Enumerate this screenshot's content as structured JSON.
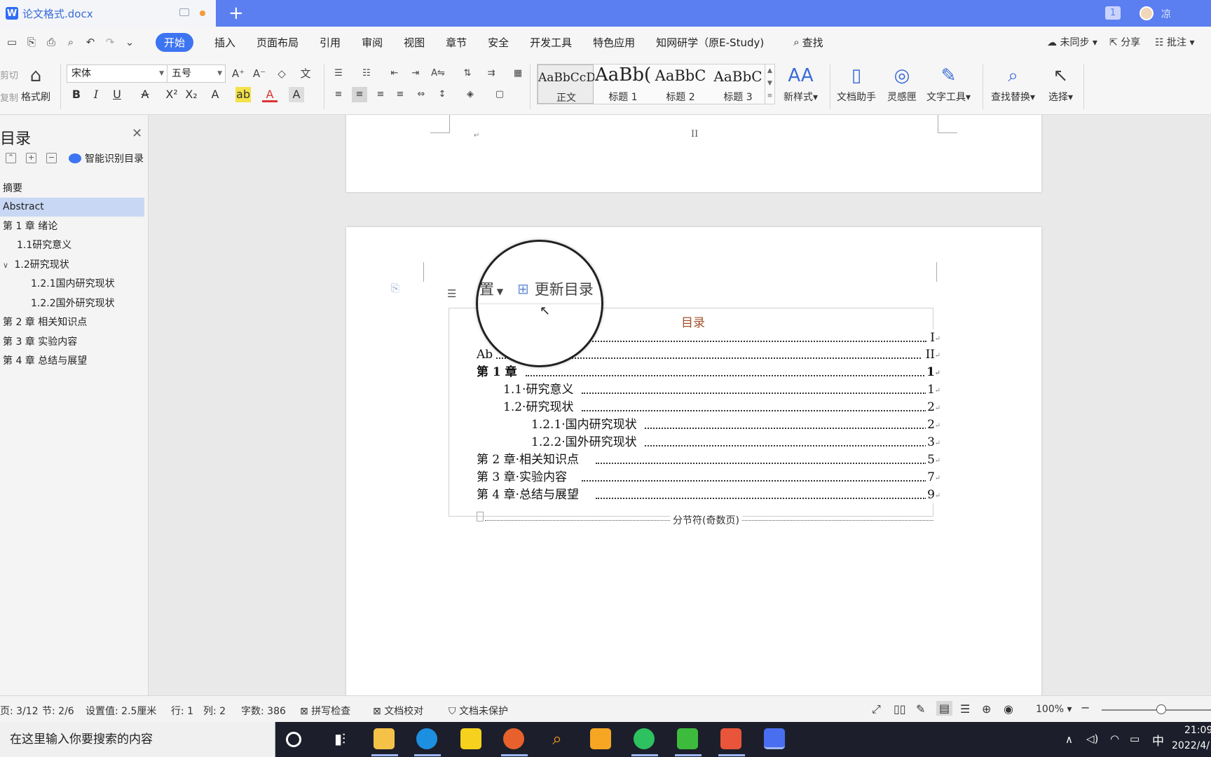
{
  "titlebar": {
    "doc_title": "论文格式.docx",
    "win_count": "1",
    "user_name": "凉",
    "new_tab_glyph": "+"
  },
  "menu": {
    "home": "开始",
    "insert": "插入",
    "layout": "页面布局",
    "reference": "引用",
    "review": "审阅",
    "view": "视图",
    "chapter": "章节",
    "security": "安全",
    "devtools": "开发工具",
    "features": "特色应用",
    "cnki": "知网研学（原E-Study)",
    "find": "查找",
    "sync": "未同步",
    "share": "分享",
    "comment": "批注"
  },
  "ribbon": {
    "cut": "剪切",
    "copy": "复制",
    "format_painter": "格式刷",
    "font_name": "宋体",
    "font_size": "五号",
    "styles": [
      {
        "sample": "AaBbCcD",
        "name": "正文"
      },
      {
        "sample": "AaBb(",
        "name": "标题 1"
      },
      {
        "sample": "AaBbC",
        "name": "标题 2"
      },
      {
        "sample": "AaBbC",
        "name": "标题 3"
      }
    ],
    "new_style": "新样式",
    "doc_assistant": "文档助手",
    "inspiration": "灵感匣",
    "text_tools": "文字工具",
    "find_replace": "查找替换",
    "select": "选择"
  },
  "nav": {
    "title": "目录",
    "smart_toc": "智能识别目录",
    "items": [
      {
        "label": "摘要"
      },
      {
        "label": "Abstract"
      },
      {
        "label": "第 1 章  绪论"
      },
      {
        "label": "1.1研究意义"
      },
      {
        "label": "1.2研究现状"
      },
      {
        "label": "1.2.1国内研究现状"
      },
      {
        "label": "1.2.2国外研究现状"
      },
      {
        "label": "第 2 章  相关知识点"
      },
      {
        "label": "第 3 章  实验内容"
      },
      {
        "label": "第 4 章  总结与展望"
      }
    ]
  },
  "document": {
    "page_number_roman": "II",
    "toc_heading": "目录",
    "toc_rows": [
      {
        "label": "",
        "page": "I"
      },
      {
        "label": "Ab",
        "page": "II"
      },
      {
        "label": "第 1 章",
        "page": "1"
      },
      {
        "label": "1.1·研究意义",
        "page": "1"
      },
      {
        "label": "1.2·研究现状",
        "page": "2"
      },
      {
        "label": "1.2.1·国内研究现状",
        "page": "2"
      },
      {
        "label": "1.2.2·国外研究现状",
        "page": "3"
      },
      {
        "label": "第 2 章·相关知识点",
        "page": "5"
      },
      {
        "label": "第 3 章·实验内容",
        "page": "7"
      },
      {
        "label": "第 4 章·总结与展望",
        "page": "9"
      }
    ],
    "section_break": "分节符(奇数页)",
    "magnifier": {
      "prev_label": "置",
      "update_toc": "更新目录"
    }
  },
  "status": {
    "page": "页: 3/12",
    "section": "节: 2/6",
    "setting": "设置值: 2.5厘米",
    "row": "行: 1",
    "col": "列: 2",
    "word_count": "字数: 386",
    "spell_check": "拼写检查",
    "proofread": "文档校对",
    "protection": "文档未保护",
    "zoom": "100%"
  },
  "taskbar": {
    "search_placeholder": "在这里输入你要搜索的内容",
    "ime": "中",
    "time": "21:09",
    "date": "2022/4/"
  },
  "colors": {
    "accent": "#3d74f2",
    "titlebar": "#5b7ff0",
    "nav_selected": "#c8d8f4",
    "toc_heading": "#a0522d"
  }
}
